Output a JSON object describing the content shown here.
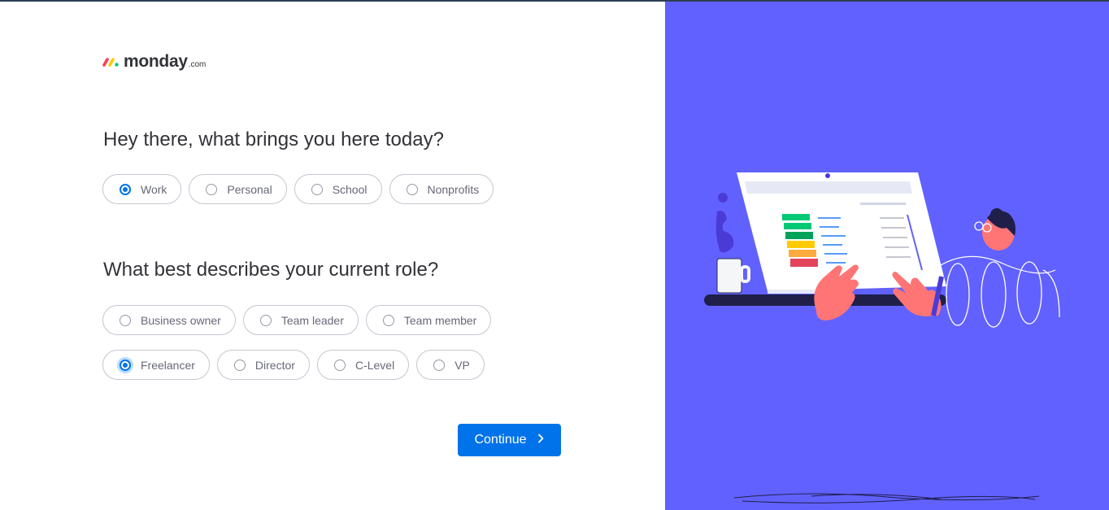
{
  "brand": {
    "wordmark": "monday",
    "suffix": ".com",
    "colors": [
      "#ff3d57",
      "#ffcb00",
      "#00ca72"
    ]
  },
  "step1": {
    "question": "Hey there, what brings you here today?",
    "options": [
      {
        "label": "Work",
        "selected": true
      },
      {
        "label": "Personal",
        "selected": false
      },
      {
        "label": "School",
        "selected": false
      },
      {
        "label": "Nonprofits",
        "selected": false
      }
    ]
  },
  "step2": {
    "question": "What best describes your current role?",
    "options": [
      {
        "label": "Business owner",
        "selected": false
      },
      {
        "label": "Team leader",
        "selected": false
      },
      {
        "label": "Team member",
        "selected": false
      },
      {
        "label": "Freelancer",
        "selected": true
      },
      {
        "label": "Director",
        "selected": false
      },
      {
        "label": "C-Level",
        "selected": false
      },
      {
        "label": "VP",
        "selected": false
      }
    ]
  },
  "actions": {
    "continue_label": "Continue",
    "continue_icon": "chevron-right-icon"
  },
  "theme": {
    "accent": "#0073ea",
    "illustration_bg": "#6161ff"
  }
}
